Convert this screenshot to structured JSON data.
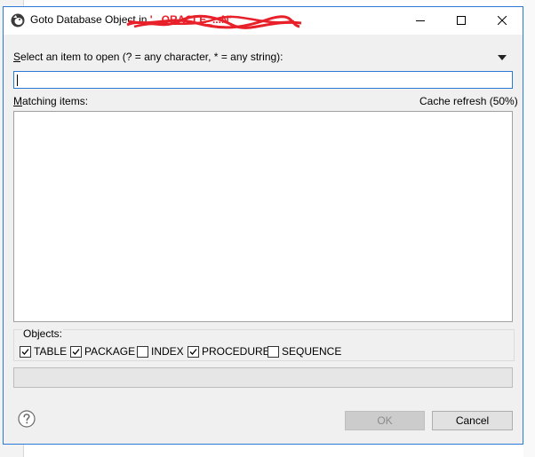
{
  "window": {
    "title_prefix": "Goto Database Object in ",
    "title_connection": "'...ORACLE_...N'"
  },
  "prompt": {
    "text": "elect an item to open (? = any character, * = any string):",
    "mnemonic": "S"
  },
  "search": {
    "value": "",
    "placeholder": ""
  },
  "matching": {
    "label_rest": "atching items:",
    "mnemonic": "M",
    "cache_status": "Cache refresh (50%)",
    "items": []
  },
  "objects": {
    "legend": "Objects:",
    "types": [
      {
        "label": "TABLE",
        "checked": true
      },
      {
        "label": "PACKAGE",
        "checked": true
      },
      {
        "label": "INDEX",
        "checked": false
      },
      {
        "label": "PROCEDURE",
        "checked": true
      },
      {
        "label": "SEQUENCE",
        "checked": false
      }
    ]
  },
  "buttons": {
    "ok": "OK",
    "cancel": "Cancel"
  },
  "icons": {
    "app": "dbeaver-icon",
    "dropdown": "triangle-down-icon",
    "help": "help-icon"
  },
  "colors": {
    "accent": "#2b79d7",
    "redaction": "#e8202a"
  }
}
